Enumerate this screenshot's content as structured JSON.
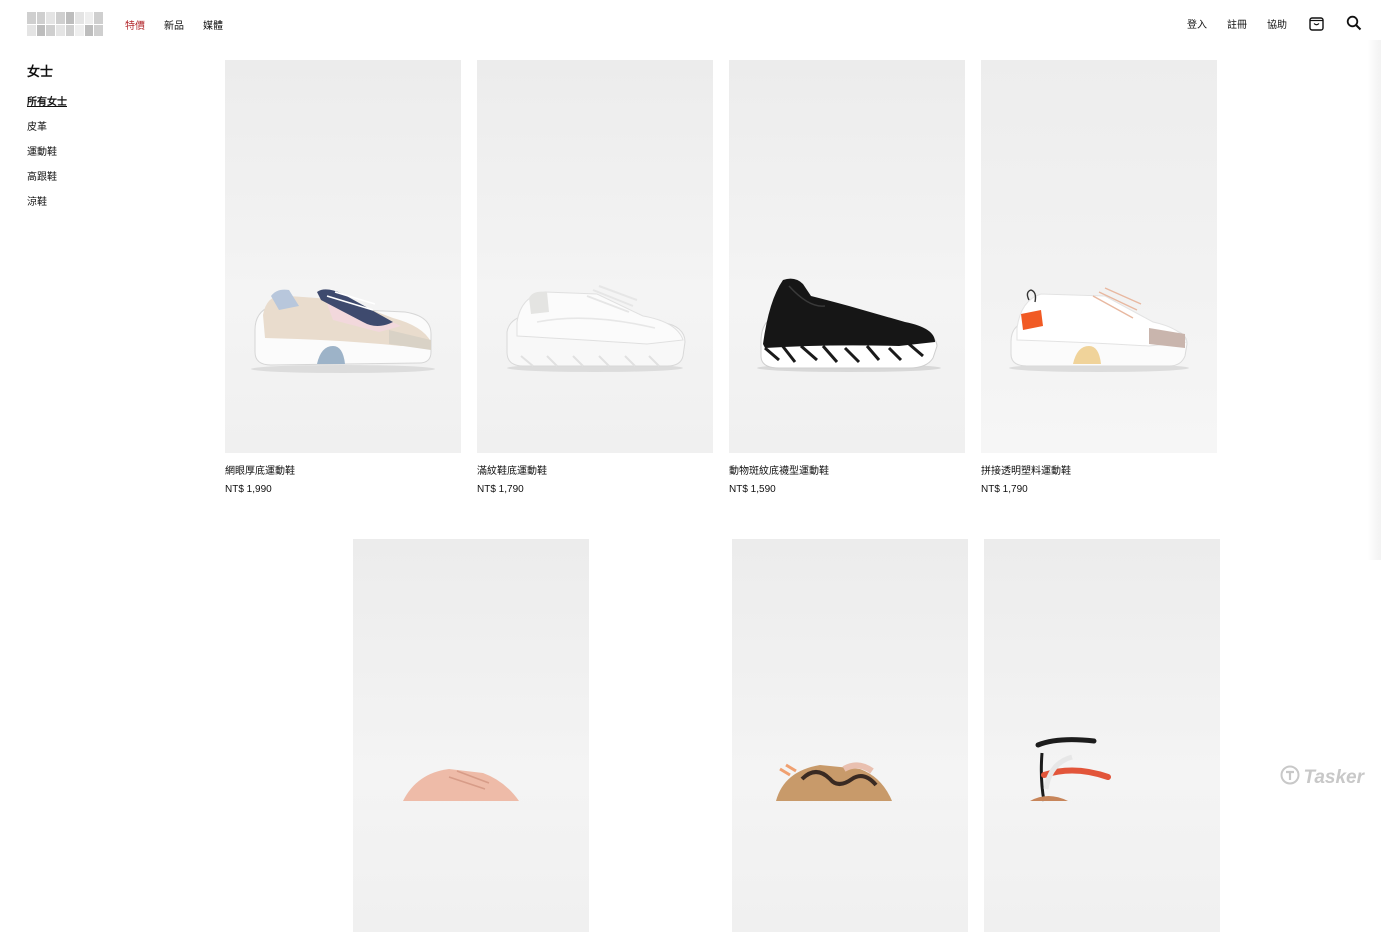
{
  "header": {
    "nav": [
      {
        "label": "特價",
        "color": "#b3282d"
      },
      {
        "label": "新品"
      },
      {
        "label": "媒體"
      }
    ],
    "login": "登入",
    "register": "註冊",
    "help": "協助",
    "cart_icon": "shopping-bag-icon",
    "search_icon": "search-icon"
  },
  "sidebar": {
    "heading": "女士",
    "items": [
      "所有女士",
      "皮革",
      "運動鞋",
      "高跟鞋",
      "涼鞋"
    ],
    "active_index": 0
  },
  "products_row1": [
    {
      "name": "網眼厚底運動鞋",
      "price": "NT$ 1,990"
    },
    {
      "name": "滿紋鞋底運動鞋",
      "price": "NT$ 1,790"
    },
    {
      "name": "動物斑紋底襪型運動鞋",
      "price": "NT$ 1,590"
    },
    {
      "name": "拼接透明塑料運動鞋",
      "price": "NT$ 1,790"
    }
  ],
  "products_row2_count": 3,
  "watermark": "Tasker",
  "colors": {
    "sale": "#b3282d",
    "photo_bg": "#efefef"
  }
}
